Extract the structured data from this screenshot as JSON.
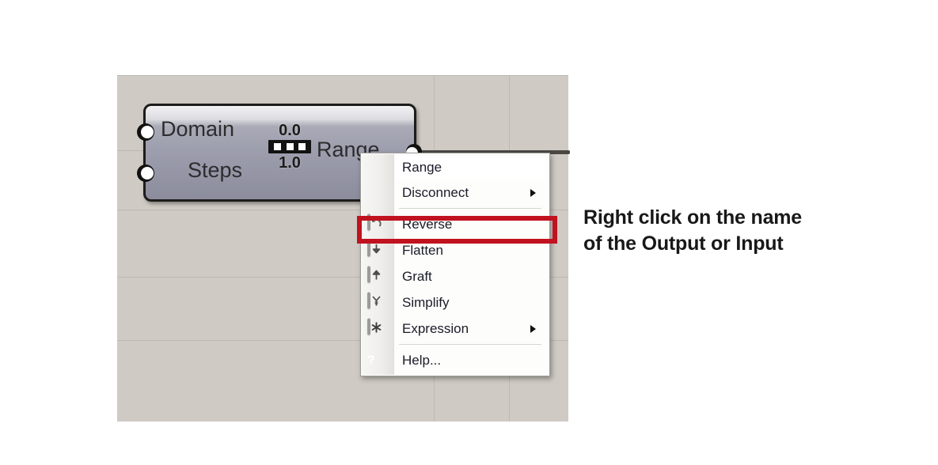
{
  "canvas": {
    "background_color": "#cfcac3",
    "grid_line_color": "#bdb8b1",
    "grid_h": [
      95,
      190,
      265,
      350,
      430
    ],
    "grid_v": [
      548,
      643
    ]
  },
  "component": {
    "name": "Range",
    "inputs": [
      {
        "label": "Domain",
        "port": "input-port"
      },
      {
        "label": "Steps",
        "port": "input-port"
      }
    ],
    "outputs": [
      {
        "label": "Range",
        "port": "output-port"
      }
    ],
    "glyph": {
      "top_value": "0.0",
      "bottom_value": "1.0",
      "segments": 3
    }
  },
  "context_menu": {
    "header": {
      "label": "Range"
    },
    "items": [
      {
        "label": "Disconnect",
        "icon": "none",
        "submenu": true
      },
      {
        "label": "Reverse",
        "icon": "reverse-icon",
        "submenu": false,
        "highlighted": true
      },
      {
        "label": "Flatten",
        "icon": "flatten-icon",
        "submenu": false
      },
      {
        "label": "Graft",
        "icon": "graft-icon",
        "submenu": false
      },
      {
        "label": "Simplify",
        "icon": "simplify-icon",
        "submenu": false
      },
      {
        "label": "Expression",
        "icon": "expression-icon",
        "submenu": true
      },
      {
        "label": "Help...",
        "icon": "help-icon",
        "submenu": false
      }
    ]
  },
  "highlight": {
    "color": "#c1121f",
    "target": "Reverse"
  },
  "annotation": {
    "line1": "Right click on the name",
    "line2": "of the Output or Input"
  }
}
